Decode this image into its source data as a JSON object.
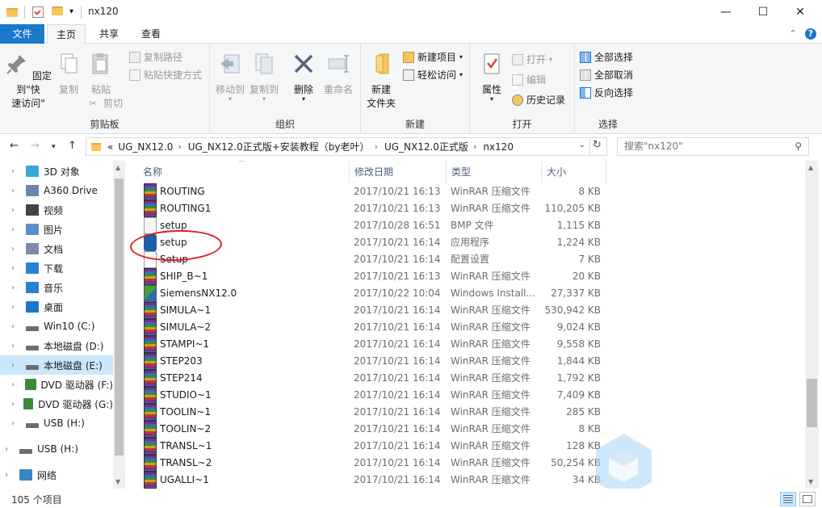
{
  "window": {
    "title": "nx120",
    "minimize_glyph": "—",
    "maximize_glyph": "☐",
    "close_glyph": "✕"
  },
  "tabs": {
    "file": "文件",
    "home": "主页",
    "share": "共享",
    "view": "查看"
  },
  "ribbon": {
    "clipboard": {
      "group_label": "剪贴板",
      "pin": "固定到\"快\n速访问\"",
      "copy": "复制",
      "paste": "粘贴",
      "copy_path": "复制路径",
      "paste_shortcut": "粘贴快捷方式",
      "cut": "剪切"
    },
    "organize": {
      "group_label": "组织",
      "move_to": "移动到",
      "copy_to": "复制到",
      "delete": "删除",
      "rename": "重命名"
    },
    "new": {
      "group_label": "新建",
      "new_folder": "新建\n文件夹",
      "new_item": "新建项目",
      "easy_access": "轻松访问"
    },
    "open": {
      "group_label": "打开",
      "properties": "属性",
      "open": "打开",
      "edit": "编辑",
      "history": "历史记录"
    },
    "select": {
      "group_label": "选择",
      "select_all": "全部选择",
      "select_none": "全部取消",
      "invert": "反向选择"
    }
  },
  "address": {
    "overflow": "«",
    "crumbs": [
      "UG_NX12.0",
      "UG_NX12.0正式版+安装教程（by老叶）",
      "UG_NX12.0正式版",
      "nx120"
    ]
  },
  "search": {
    "placeholder": "搜索\"nx120\""
  },
  "nav": {
    "items": [
      {
        "label": "3D 对象",
        "icon": "3d-objects-icon"
      },
      {
        "label": "A360 Drive",
        "icon": "cloud-drive-icon"
      },
      {
        "label": "视频",
        "icon": "video-icon"
      },
      {
        "label": "图片",
        "icon": "pictures-icon"
      },
      {
        "label": "文档",
        "icon": "documents-icon"
      },
      {
        "label": "下载",
        "icon": "download-icon"
      },
      {
        "label": "音乐",
        "icon": "music-icon"
      },
      {
        "label": "桌面",
        "icon": "desktop-icon"
      },
      {
        "label": "Win10 (C:)",
        "icon": "drive-icon"
      },
      {
        "label": "本地磁盘 (D:)",
        "icon": "drive-icon"
      },
      {
        "label": "本地磁盘 (E:)",
        "icon": "drive-icon"
      },
      {
        "label": "DVD 驱动器 (F:)",
        "icon": "dvd-icon"
      },
      {
        "label": "DVD 驱动器 (G:)",
        "icon": "dvd-icon"
      },
      {
        "label": "USB (H:)",
        "icon": "usb-drive-icon"
      },
      {
        "label": "USB (H:)",
        "icon": "usb-drive-icon"
      },
      {
        "label": "网络",
        "icon": "network-icon"
      }
    ]
  },
  "columns": {
    "name": "名称",
    "date": "修改日期",
    "type": "类型",
    "size": "大小"
  },
  "files": [
    {
      "name": "ROUTING",
      "date": "2017/10/21 16:13",
      "type": "WinRAR 压缩文件",
      "size": "8 KB",
      "kind": "rar"
    },
    {
      "name": "ROUTING1",
      "date": "2017/10/21 16:13",
      "type": "WinRAR 压缩文件",
      "size": "110,205 KB",
      "kind": "rar"
    },
    {
      "name": "setup",
      "date": "2017/10/28 16:51",
      "type": "BMP 文件",
      "size": "1,115 KB",
      "kind": "bmp"
    },
    {
      "name": "setup",
      "date": "2017/10/21 16:14",
      "type": "应用程序",
      "size": "1,224 KB",
      "kind": "exe"
    },
    {
      "name": "Setup",
      "date": "2017/10/21 16:14",
      "type": "配置设置",
      "size": "7 KB",
      "kind": "cfg"
    },
    {
      "name": "SHIP_B~1",
      "date": "2017/10/21 16:13",
      "type": "WinRAR 压缩文件",
      "size": "20 KB",
      "kind": "rar"
    },
    {
      "name": "SiemensNX12.0",
      "date": "2017/10/22 10:04",
      "type": "Windows Install...",
      "size": "27,337 KB",
      "kind": "msi"
    },
    {
      "name": "SIMULA~1",
      "date": "2017/10/21 16:14",
      "type": "WinRAR 压缩文件",
      "size": "530,942 KB",
      "kind": "rar"
    },
    {
      "name": "SIMULA~2",
      "date": "2017/10/21 16:14",
      "type": "WinRAR 压缩文件",
      "size": "9,024 KB",
      "kind": "rar"
    },
    {
      "name": "STAMPI~1",
      "date": "2017/10/21 16:14",
      "type": "WinRAR 压缩文件",
      "size": "9,558 KB",
      "kind": "rar"
    },
    {
      "name": "STEP203",
      "date": "2017/10/21 16:14",
      "type": "WinRAR 压缩文件",
      "size": "1,844 KB",
      "kind": "rar"
    },
    {
      "name": "STEP214",
      "date": "2017/10/21 16:14",
      "type": "WinRAR 压缩文件",
      "size": "1,792 KB",
      "kind": "rar"
    },
    {
      "name": "STUDIO~1",
      "date": "2017/10/21 16:14",
      "type": "WinRAR 压缩文件",
      "size": "7,409 KB",
      "kind": "rar"
    },
    {
      "name": "TOOLIN~1",
      "date": "2017/10/21 16:14",
      "type": "WinRAR 压缩文件",
      "size": "285 KB",
      "kind": "rar"
    },
    {
      "name": "TOOLIN~2",
      "date": "2017/10/21 16:14",
      "type": "WinRAR 压缩文件",
      "size": "8 KB",
      "kind": "rar"
    },
    {
      "name": "TRANSL~1",
      "date": "2017/10/21 16:14",
      "type": "WinRAR 压缩文件",
      "size": "128 KB",
      "kind": "rar"
    },
    {
      "name": "TRANSL~2",
      "date": "2017/10/21 16:14",
      "type": "WinRAR 压缩文件",
      "size": "50,254 KB",
      "kind": "rar"
    },
    {
      "name": "UGALLI~1",
      "date": "2017/10/21 16:14",
      "type": "WinRAR 压缩文件",
      "size": "34 KB",
      "kind": "rar"
    }
  ],
  "status": {
    "count": "105 个项目"
  },
  "colors": {
    "accent": "#1979ca",
    "selection": "#cce8ff",
    "annotation": "#e02020"
  }
}
